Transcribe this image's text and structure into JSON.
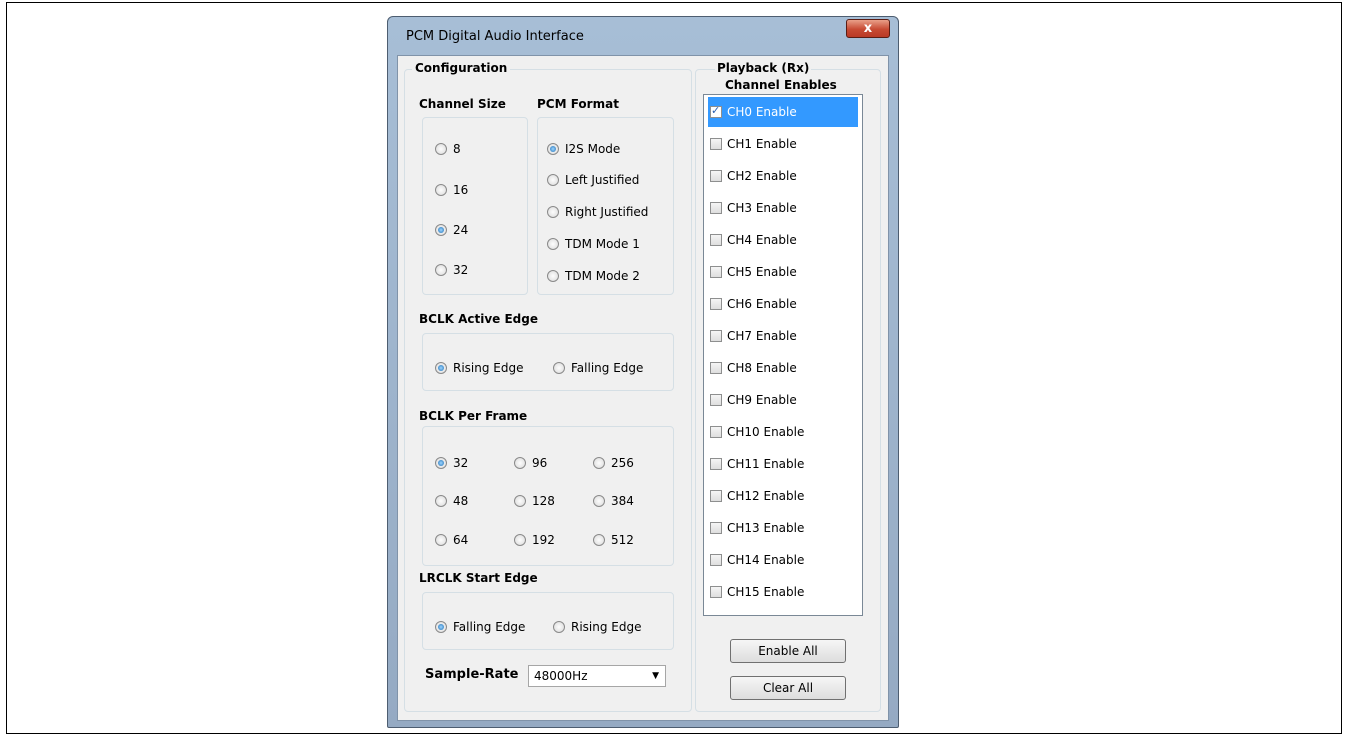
{
  "window": {
    "title": "PCM Digital Audio Interface",
    "close_glyph": "x"
  },
  "configuration": {
    "legend": "Configuration",
    "channel_size": {
      "label": "Channel Size",
      "options": [
        "8",
        "16",
        "24",
        "32"
      ],
      "selected": "24"
    },
    "pcm_format": {
      "label": "PCM Format",
      "options": [
        "I2S Mode",
        "Left Justified",
        "Right Justified",
        "TDM Mode 1",
        "TDM Mode 2"
      ],
      "selected": "I2S Mode"
    },
    "bclk_active_edge": {
      "label": "BCLK Active Edge",
      "options": [
        "Rising Edge",
        "Falling Edge"
      ],
      "selected": "Rising Edge"
    },
    "bclk_per_frame": {
      "label": "BCLK Per Frame",
      "options": [
        "32",
        "96",
        "256",
        "48",
        "128",
        "384",
        "64",
        "192",
        "512"
      ],
      "selected": "32"
    },
    "lrclk_start_edge": {
      "label": "LRCLK Start Edge",
      "options": [
        "Falling Edge",
        "Rising Edge"
      ],
      "selected": "Falling Edge"
    },
    "sample_rate": {
      "label": "Sample-Rate",
      "value": "48000Hz"
    }
  },
  "playback": {
    "legend_line1": "Playback (Rx)",
    "legend_line2": "Channel Enables",
    "channels": [
      {
        "label": "CH0 Enable",
        "checked": true
      },
      {
        "label": "CH1 Enable",
        "checked": false
      },
      {
        "label": "CH2 Enable",
        "checked": false
      },
      {
        "label": "CH3 Enable",
        "checked": false
      },
      {
        "label": "CH4 Enable",
        "checked": false
      },
      {
        "label": "CH5 Enable",
        "checked": false
      },
      {
        "label": "CH6 Enable",
        "checked": false
      },
      {
        "label": "CH7 Enable",
        "checked": false
      },
      {
        "label": "CH8 Enable",
        "checked": false
      },
      {
        "label": "CH9 Enable",
        "checked": false
      },
      {
        "label": "CH10 Enable",
        "checked": false
      },
      {
        "label": "CH11 Enable",
        "checked": false
      },
      {
        "label": "CH12 Enable",
        "checked": false
      },
      {
        "label": "CH13 Enable",
        "checked": false
      },
      {
        "label": "CH14 Enable",
        "checked": false
      },
      {
        "label": "CH15 Enable",
        "checked": false
      }
    ],
    "enable_all_label": "Enable All",
    "clear_all_label": "Clear All"
  }
}
